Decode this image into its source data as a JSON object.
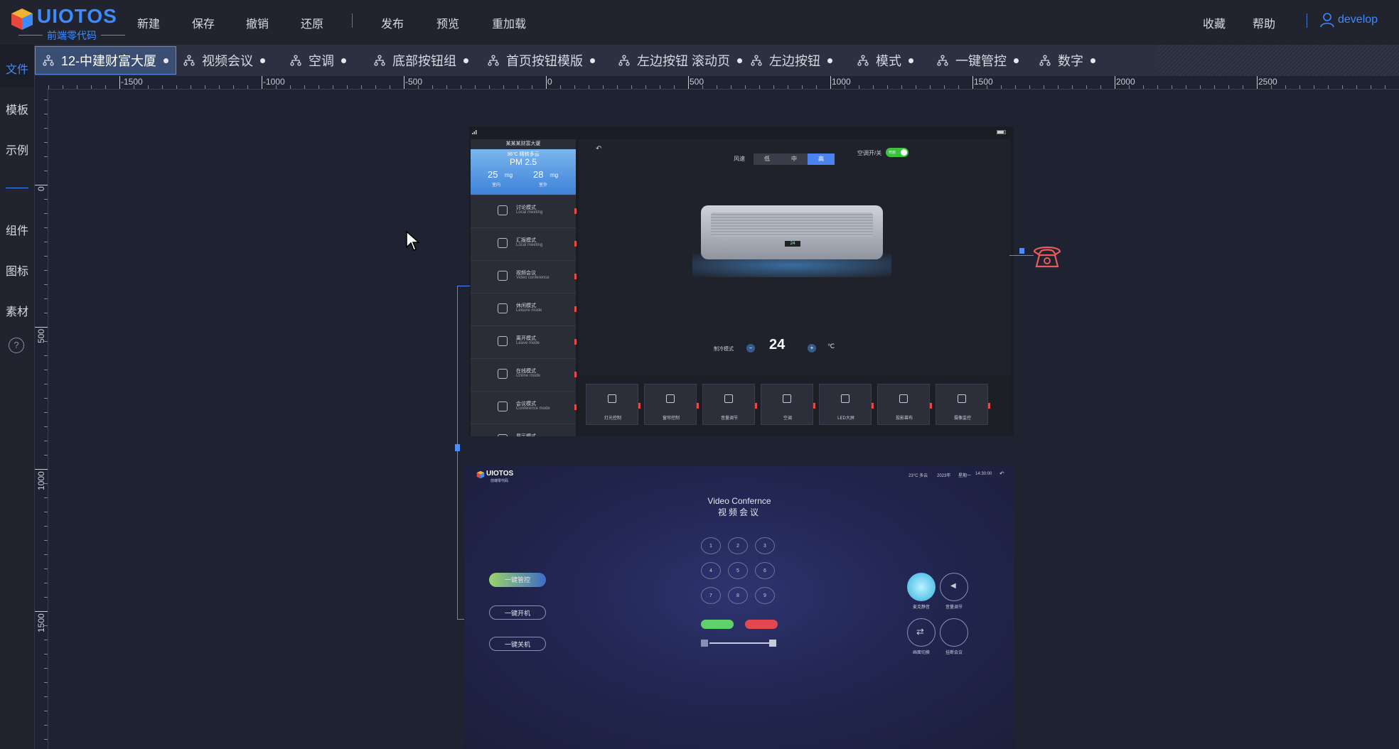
{
  "app": {
    "logo_title": "UIOTOS",
    "logo_sub": "前端零代码"
  },
  "menu": [
    "新建",
    "保存",
    "撤销",
    "还原",
    "发布",
    "预览",
    "重加载"
  ],
  "right_menu": [
    "收藏",
    "帮助"
  ],
  "user": "develop",
  "sidebar": {
    "items": [
      "文件",
      "模板",
      "示例",
      "组件",
      "图标",
      "素材"
    ],
    "help": "?"
  },
  "tabs": [
    "12-中建财富大厦",
    "视频会议",
    "空调",
    "底部按钮组",
    "首页按钮模版",
    "左边按钮 滚动页",
    "左边按钮",
    "模式",
    "一键管控",
    "数字"
  ],
  "ruler": {
    "h_labels": [
      "-1500",
      "-1000",
      "-500",
      "0",
      "500",
      "1000",
      "1500",
      "2000",
      "2500"
    ],
    "v_labels": [
      "0",
      "500",
      "1000",
      "1500"
    ]
  },
  "canvas1": {
    "left_title": "某某某财富大厦",
    "weather_top": "36°C 晴转多云",
    "pm_label": "PM 2.5",
    "pm_in": "25",
    "pm_in_unit": "mg",
    "pm_in_label": "室内",
    "pm_out": "28",
    "pm_out_unit": "mg",
    "pm_out_label": "室外",
    "modes": [
      {
        "cn": "讨论模式",
        "en": "Local meeting"
      },
      {
        "cn": "汇报模式",
        "en": "Local meeting"
      },
      {
        "cn": "视频会议",
        "en": "Video conference"
      },
      {
        "cn": "休闲模式",
        "en": "Leisure mode"
      },
      {
        "cn": "离开模式",
        "en": "Leave mode"
      },
      {
        "cn": "在线模式",
        "en": "Online mode"
      },
      {
        "cn": "会议模式",
        "en": "Conference mode"
      },
      {
        "cn": "展示模式",
        "en": ""
      }
    ],
    "wind_label": "风速",
    "wind_options": [
      "低",
      "中",
      "高"
    ],
    "wind_selected": "高",
    "ac_switch_label": "空调开/关",
    "ac_switch_state": "开启",
    "ac_display": "24",
    "mode_label": "制冷模式",
    "temperature": "24",
    "unit": "℃",
    "devices": [
      "灯光控制",
      "窗帘控制",
      "音量调节",
      "空调",
      "LED大屏",
      "投影幕布",
      "摄像监控"
    ]
  },
  "canvas2": {
    "logo": "UIOTOS",
    "logo_sub": "前端零代码",
    "status_items": [
      "23°C 多云",
      "2023年",
      "星期一",
      "14:30:00"
    ],
    "title_en": "Video Confernce",
    "title_cn": "视频会议",
    "keys": [
      "1",
      "2",
      "3",
      "4",
      "5",
      "6",
      "7",
      "8",
      "9"
    ],
    "buttons": [
      "一键管控",
      "一键开机",
      "一键关机"
    ],
    "right_labels": [
      "麦克静音",
      "音量调节",
      "画面切换",
      "挂断会议"
    ]
  },
  "colors": {
    "accent": "#3d8bff",
    "background": "#1f2230",
    "tab_active": "#3a4e73",
    "alert": "#e84a4a",
    "switch_on": "#3cc23c"
  }
}
